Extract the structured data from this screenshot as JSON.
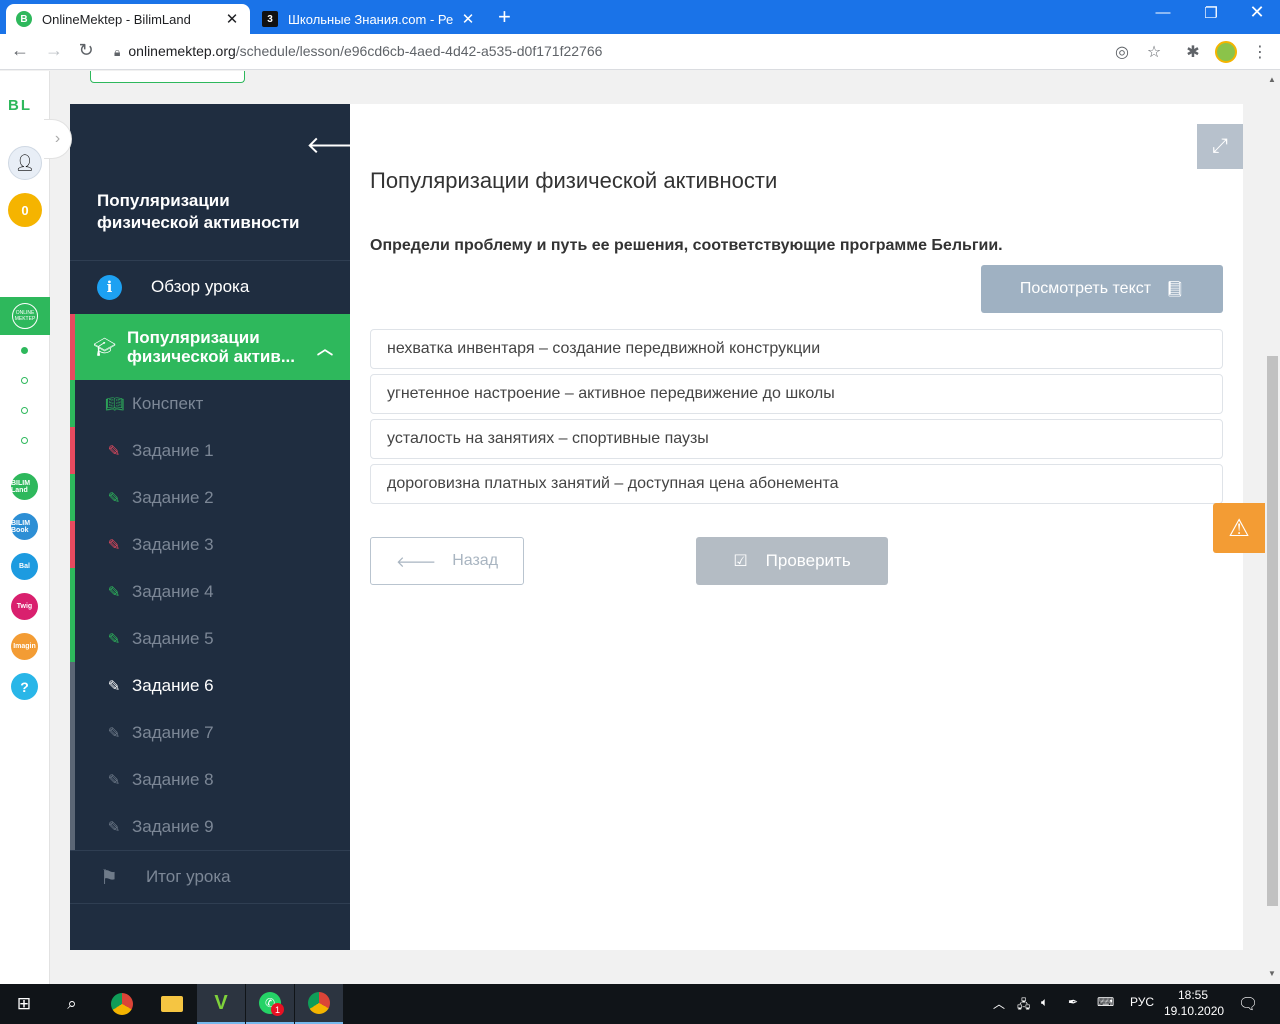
{
  "browser": {
    "tabs": [
      {
        "title": "OnlineMektep - BilimLand",
        "favicon": "B",
        "active": true
      },
      {
        "title": "Школьные Знания.com - Решае",
        "favicon": "3",
        "active": false
      }
    ],
    "url_host": "onlinemektep.org",
    "url_path": "/schedule/lesson/e96cd6cb-4aed-4d42-a535-d0f171f22766",
    "accent_color": "#1a73e8"
  },
  "rail": {
    "logo": "BL",
    "coins": "0",
    "onlinemektep_label": "ONLINE MEKTEP",
    "apps": [
      "BILIM Land",
      "BILIM Book",
      "Bal",
      "Twig",
      "Imagin",
      "?"
    ]
  },
  "sidebar": {
    "title": "Популяризации физической активности",
    "overview": "Обзор урока",
    "section": "Популяризации физической актив...",
    "items": [
      {
        "label": "Конспект",
        "icon": "book-icon",
        "status": "done"
      },
      {
        "label": "Задание 1",
        "icon": "edit-icon",
        "status": "wrong"
      },
      {
        "label": "Задание 2",
        "icon": "edit-icon",
        "status": "done"
      },
      {
        "label": "Задание 3",
        "icon": "edit-icon",
        "status": "wrong"
      },
      {
        "label": "Задание 4",
        "icon": "edit-icon",
        "status": "done"
      },
      {
        "label": "Задание 5",
        "icon": "edit-icon",
        "status": "done"
      },
      {
        "label": "Задание 6",
        "icon": "edit-icon",
        "status": "current"
      },
      {
        "label": "Задание 7",
        "icon": "edit-icon",
        "status": "locked"
      },
      {
        "label": "Задание 8",
        "icon": "edit-icon",
        "status": "locked"
      },
      {
        "label": "Задание 9",
        "icon": "edit-icon",
        "status": "locked"
      }
    ],
    "result": "Итог урока",
    "colors": {
      "done": "#2eb85c",
      "wrong": "#e84a5f",
      "bg": "#1f2d40"
    }
  },
  "main": {
    "title": "Популяризации физической активности",
    "question": "Определи проблему и путь ее решения, соответствующие программе Бельгии.",
    "view_text_button": "Посмотреть текст",
    "options": [
      "нехватка инвентаря – создание передвижной конструкции",
      "угнетенное настроение – активное передвижение до школы",
      "усталость на занятиях – спортивные паузы",
      "дороговизна платных занятий – доступная цена абонемента"
    ],
    "back_button": "Назад",
    "check_button": "Проверить"
  },
  "taskbar": {
    "language": "РУС",
    "time": "18:55",
    "date": "19.10.2020",
    "whatsapp_badge": "1"
  }
}
